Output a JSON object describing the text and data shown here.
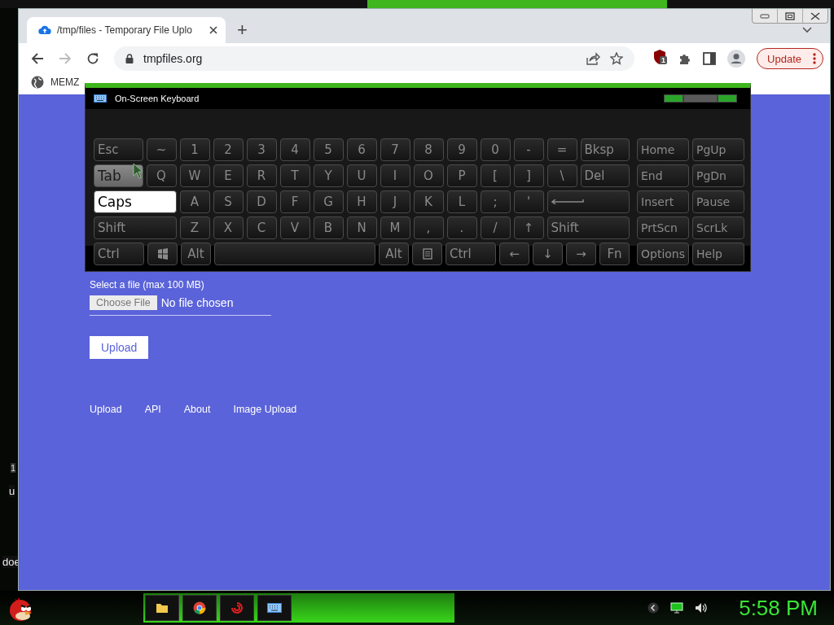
{
  "desktop": {
    "fragments": [
      "1",
      "u",
      "doe"
    ]
  },
  "browser": {
    "tabs": [
      {
        "title": "/tmp/files - Temporary File Uplo",
        "selected": true
      }
    ],
    "new_tab": "+",
    "forward_disabled": true,
    "address": "tmpfiles.org",
    "extension_badge": "1",
    "update_button": "Update",
    "bookmarks": [
      {
        "label": "MEMZ"
      }
    ]
  },
  "page": {
    "file_label": "Select a file (max 100 MB)",
    "choose_button": "Choose File",
    "file_status": "No file chosen",
    "upload_button": "Upload",
    "footer_links": [
      "Upload",
      "API",
      "About",
      "Image Upload"
    ]
  },
  "keyboard": {
    "title": "On-Screen Keyboard",
    "rows": [
      {
        "main": [
          {
            "label": "Esc",
            "kind": "mod",
            "hovered": false,
            "on": false
          },
          {
            "label": "~",
            "kind": "char",
            "hovered": false,
            "on": false
          },
          {
            "label": "1",
            "kind": "char",
            "hovered": false,
            "on": false
          },
          {
            "label": "2",
            "kind": "char",
            "hovered": false,
            "on": false
          },
          {
            "label": "3",
            "kind": "char",
            "hovered": false,
            "on": false
          },
          {
            "label": "4",
            "kind": "char",
            "hovered": false,
            "on": false
          },
          {
            "label": "5",
            "kind": "char",
            "hovered": false,
            "on": false
          },
          {
            "label": "6",
            "kind": "char",
            "hovered": false,
            "on": false
          },
          {
            "label": "7",
            "kind": "char",
            "hovered": false,
            "on": false
          },
          {
            "label": "8",
            "kind": "char",
            "hovered": false,
            "on": false
          },
          {
            "label": "9",
            "kind": "char",
            "hovered": false,
            "on": false
          },
          {
            "label": "0",
            "kind": "char",
            "hovered": false,
            "on": false
          },
          {
            "label": "-",
            "kind": "char",
            "hovered": false,
            "on": false
          },
          {
            "label": "=",
            "kind": "char",
            "hovered": false,
            "on": false
          },
          {
            "label": "Bksp",
            "kind": "mod",
            "hovered": false,
            "on": false
          }
        ],
        "side": [
          {
            "label": "Home",
            "kind": "side",
            "hovered": false,
            "on": false
          },
          {
            "label": "PgUp",
            "kind": "side",
            "hovered": false,
            "on": false
          }
        ]
      },
      {
        "main": [
          {
            "label": "Tab",
            "kind": "mod",
            "hovered": true,
            "on": false
          },
          {
            "label": "Q",
            "kind": "char",
            "hovered": false,
            "on": false
          },
          {
            "label": "W",
            "kind": "char",
            "hovered": false,
            "on": false
          },
          {
            "label": "E",
            "kind": "char",
            "hovered": false,
            "on": false
          },
          {
            "label": "R",
            "kind": "char",
            "hovered": false,
            "on": false
          },
          {
            "label": "T",
            "kind": "char",
            "hovered": false,
            "on": false
          },
          {
            "label": "Y",
            "kind": "char",
            "hovered": false,
            "on": false
          },
          {
            "label": "U",
            "kind": "char",
            "hovered": false,
            "on": false
          },
          {
            "label": "I",
            "kind": "char",
            "hovered": false,
            "on": false
          },
          {
            "label": "O",
            "kind": "char",
            "hovered": false,
            "on": false
          },
          {
            "label": "P",
            "kind": "char",
            "hovered": false,
            "on": false
          },
          {
            "label": "[",
            "kind": "char",
            "hovered": false,
            "on": false
          },
          {
            "label": "]",
            "kind": "char",
            "hovered": false,
            "on": false
          },
          {
            "label": "\\",
            "kind": "char",
            "hovered": false,
            "on": false
          },
          {
            "label": "Del",
            "kind": "mod",
            "hovered": false,
            "on": false
          }
        ],
        "side": [
          {
            "label": "End",
            "kind": "side",
            "hovered": false,
            "on": false
          },
          {
            "label": "PgDn",
            "kind": "side",
            "hovered": false,
            "on": false
          }
        ]
      },
      {
        "main": [
          {
            "label": "Caps",
            "kind": "mod",
            "hovered": false,
            "on": true
          },
          {
            "label": "A",
            "kind": "char",
            "hovered": false,
            "on": false
          },
          {
            "label": "S",
            "kind": "char",
            "hovered": false,
            "on": false
          },
          {
            "label": "D",
            "kind": "char",
            "hovered": false,
            "on": false
          },
          {
            "label": "F",
            "kind": "char",
            "hovered": false,
            "on": false
          },
          {
            "label": "G",
            "kind": "char",
            "hovered": false,
            "on": false
          },
          {
            "label": "H",
            "kind": "char",
            "hovered": false,
            "on": false
          },
          {
            "label": "J",
            "kind": "char",
            "hovered": false,
            "on": false
          },
          {
            "label": "K",
            "kind": "char",
            "hovered": false,
            "on": false
          },
          {
            "label": "L",
            "kind": "char",
            "hovered": false,
            "on": false
          },
          {
            "label": ";",
            "kind": "char",
            "hovered": false,
            "on": false
          },
          {
            "label": "'",
            "kind": "char",
            "hovered": false,
            "on": false
          },
          {
            "kind": "enter",
            "hovered": false,
            "on": false
          }
        ],
        "side": [
          {
            "label": "Insert",
            "kind": "side",
            "hovered": false,
            "on": false
          },
          {
            "label": "Pause",
            "kind": "side",
            "hovered": false,
            "on": false
          }
        ]
      },
      {
        "main": [
          {
            "label": "Shift",
            "kind": "mod",
            "hovered": false,
            "on": false
          },
          {
            "label": "Z",
            "kind": "char",
            "hovered": false,
            "on": false
          },
          {
            "label": "X",
            "kind": "char",
            "hovered": false,
            "on": false
          },
          {
            "label": "C",
            "kind": "char",
            "hovered": false,
            "on": false
          },
          {
            "label": "V",
            "kind": "char",
            "hovered": false,
            "on": false
          },
          {
            "label": "B",
            "kind": "char",
            "hovered": false,
            "on": false
          },
          {
            "label": "N",
            "kind": "char",
            "hovered": false,
            "on": false
          },
          {
            "label": "M",
            "kind": "char",
            "hovered": false,
            "on": false
          },
          {
            "label": ",",
            "kind": "char",
            "hovered": false,
            "on": false
          },
          {
            "label": ".",
            "kind": "char",
            "hovered": false,
            "on": false
          },
          {
            "label": "/",
            "kind": "char",
            "hovered": false,
            "on": false
          },
          {
            "label": "↑",
            "kind": "char",
            "hovered": false,
            "on": false
          },
          {
            "label": "Shift",
            "kind": "mod",
            "hovered": false,
            "on": false
          }
        ],
        "side": [
          {
            "label": "PrtScn",
            "kind": "side",
            "hovered": false,
            "on": false
          },
          {
            "label": "ScrLk",
            "kind": "side",
            "hovered": false,
            "on": false
          }
        ]
      },
      {
        "main": [
          {
            "label": "Ctrl",
            "kind": "mod",
            "hovered": false,
            "on": false
          },
          {
            "kind": "win",
            "hovered": false,
            "on": false
          },
          {
            "label": "Alt",
            "kind": "char",
            "hovered": false,
            "on": false
          },
          {
            "kind": "space",
            "hovered": false,
            "on": false
          },
          {
            "label": "Alt",
            "kind": "char",
            "hovered": false,
            "on": false
          },
          {
            "kind": "menu",
            "hovered": false,
            "on": false
          },
          {
            "label": "Ctrl",
            "kind": "mod",
            "hovered": false,
            "on": false
          },
          {
            "label": "←",
            "kind": "char",
            "hovered": false,
            "on": false
          },
          {
            "label": "↓",
            "kind": "char",
            "hovered": false,
            "on": false
          },
          {
            "label": "→",
            "kind": "char",
            "hovered": false,
            "on": false
          },
          {
            "label": "Fn",
            "kind": "char",
            "hovered": false,
            "on": false
          }
        ],
        "side": [
          {
            "label": "Options",
            "kind": "side",
            "hovered": false,
            "on": false
          },
          {
            "label": "Help",
            "kind": "side",
            "hovered": false,
            "on": false
          }
        ]
      }
    ]
  },
  "taskbar": {
    "clock": "5:58 PM"
  }
}
